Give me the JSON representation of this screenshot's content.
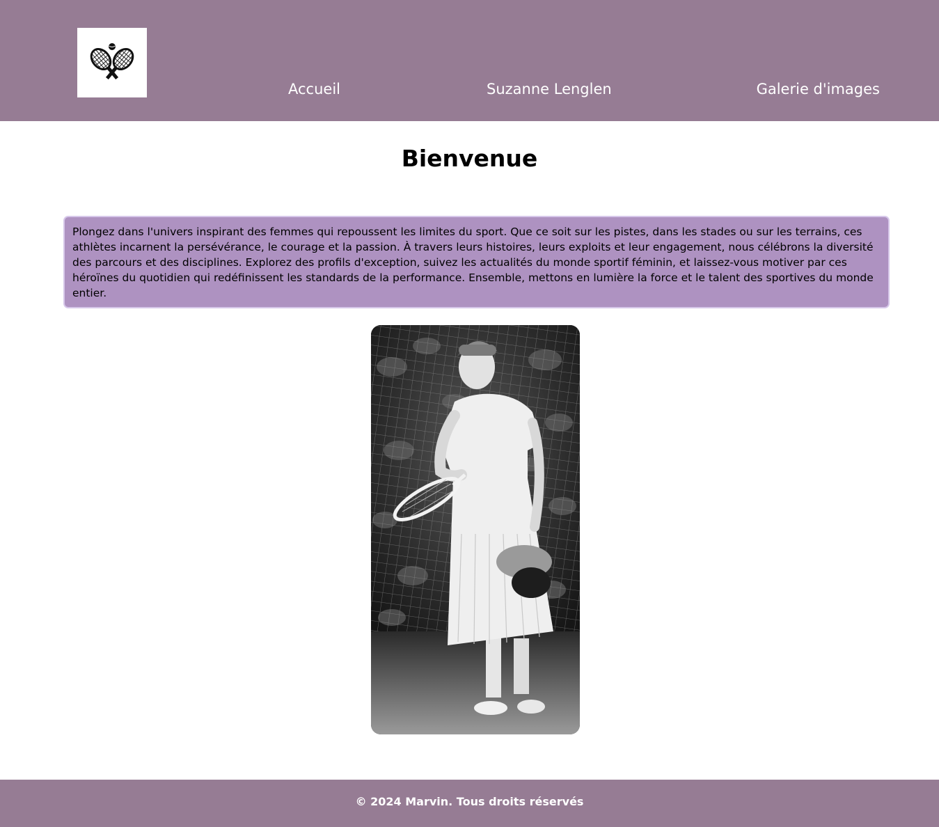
{
  "colors": {
    "header_bg": "#967c94",
    "footer_bg": "#967c94",
    "intro_bg": "#ae92c1",
    "intro_border": "#d7c8ea",
    "text_light": "#ffffff",
    "text_dark": "#000000"
  },
  "header": {
    "logo_icon": "crossed-tennis-rackets-icon",
    "nav": [
      {
        "label": "Accueil"
      },
      {
        "label": "Suzanne Lenglen"
      },
      {
        "label": "Galerie d'images"
      }
    ]
  },
  "main": {
    "title": "Bienvenue",
    "intro": "Plongez dans l'univers inspirant des femmes qui repoussent les limites du sport. Que ce soit sur les pistes, dans les stades ou sur les terrains, ces athlètes incarnent la persévérance, le courage et la passion. À travers leurs histoires, leurs exploits et leur engagement, nous célébrons la diversité des parcours et des disciplines. Explorez des profils d'exception, suivez les actualités du monde sportif féminin, et laissez-vous motiver par ces héroïnes du quotidien qui redéfinissent les standards de la performance. Ensemble, mettons en lumière la force et le talent des sportives du monde entier.",
    "photo_subject": "black-and-white photo of a female tennis player in white dress holding a racket"
  },
  "footer": {
    "copyright": "© 2024 Marvin. Tous droits réservés"
  }
}
